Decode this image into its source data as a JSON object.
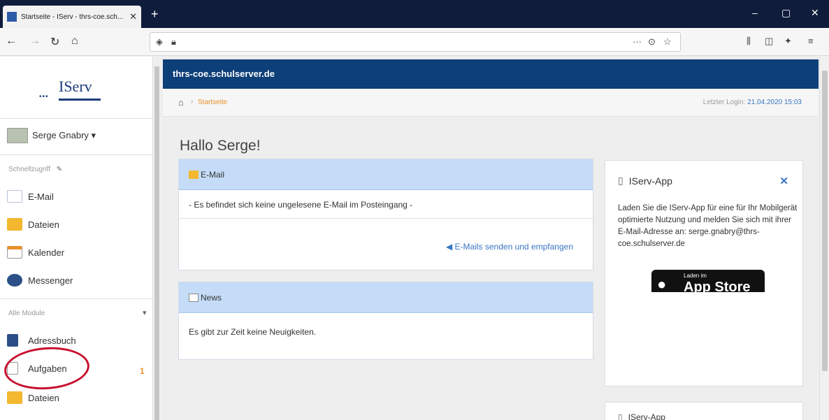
{
  "browser": {
    "tab_title": "Startseite - IServ - thrs-coe.sch...",
    "tab_close": "✕",
    "new_tab": "+",
    "minimize": "–",
    "maximize": "▢",
    "close": "✕",
    "url": ""
  },
  "sidebar": {
    "logo_text": "IServ",
    "user_name": "Serge Gnabry ▾",
    "quick_heading": "Schnellzugriff",
    "quick_items": [
      {
        "label": "E-Mail"
      },
      {
        "label": "Dateien"
      },
      {
        "label": "Kalender"
      },
      {
        "label": "Messenger"
      }
    ],
    "modules_heading": "Alle Module",
    "module_items": [
      {
        "label": "Adressbuch"
      },
      {
        "label": "Aufgaben",
        "badge": "1"
      },
      {
        "label": "Dateien"
      }
    ]
  },
  "header": {
    "site": "thrs-coe.schulserver.de"
  },
  "breadcrumb": {
    "current": "Startseite",
    "last_login_label": "Letzter Login: ",
    "last_login_value": "21.04.2020 15:03"
  },
  "main": {
    "greeting": "Hallo Serge!",
    "email_panel": {
      "title": "E-Mail",
      "message": "- Es befindet sich keine ungelesene E-Mail im Posteingang -",
      "link": "E-Mails senden und empfangen"
    },
    "news_panel": {
      "title": "News",
      "message": "Es gibt zur Zeit keine Neuigkeiten."
    }
  },
  "app_panel": {
    "title": "IServ-App",
    "close": "✕",
    "text": "Laden Sie die IServ-App für eine für Ihr Mobilgerät optimierte Nutzung und melden Sie sich mit ihrer E-Mail-Adresse an: serge.gnabry@thrs-coe.schulserver.de",
    "store_small": "Laden im",
    "store_big": "App Store",
    "second_title": "IServ-App"
  },
  "colors": {
    "header_bg": "#0d3f78",
    "panel_head_bg": "#c4dcf7",
    "accent_orange": "#e8902a",
    "link_blue": "#3a76c3",
    "annotation_red": "#c8102e"
  }
}
